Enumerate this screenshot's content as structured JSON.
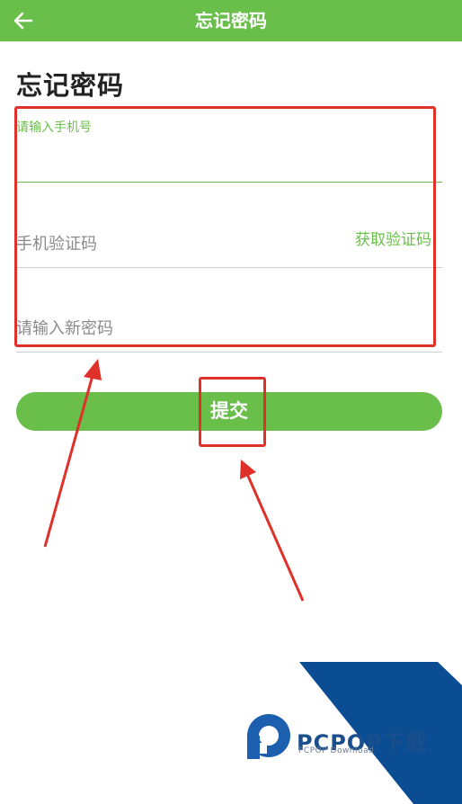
{
  "header": {
    "title": "忘记密码",
    "back_icon": "arrow-left-icon"
  },
  "page": {
    "title": "忘记密码"
  },
  "form": {
    "phone_label": "请输入手机号",
    "phone_value": "",
    "code_placeholder": "手机验证码",
    "get_code_label": "获取验证码",
    "password_placeholder": "请输入新密码"
  },
  "submit": {
    "label": "提交"
  },
  "watermark": {
    "brand": "PCPOP下载",
    "sub": "PCPOP Download"
  },
  "colors": {
    "accent": "#6abf4b",
    "annotation": "#e0302a",
    "watermark_blue": "#1b4f8c"
  }
}
